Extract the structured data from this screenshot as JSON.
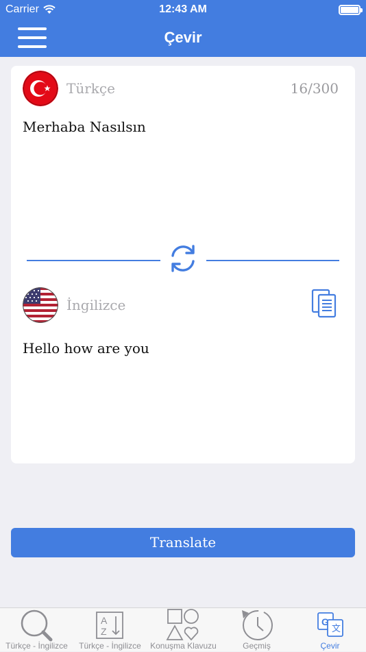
{
  "status_bar": {
    "carrier": "Carrier",
    "time": "12:43 AM"
  },
  "nav": {
    "title": "Çevir"
  },
  "source": {
    "language": "Türkçe",
    "counter": "16/300",
    "text": "Merhaba Nasılsın",
    "flag_icon": "turkey-flag-icon"
  },
  "target": {
    "language": "İngilizce",
    "text": "Hello how are you",
    "flag_icon": "usa-flag-icon"
  },
  "translate_label": "Translate",
  "tabs": [
    {
      "label": "Türkçe - İngilizce",
      "icon": "search-icon"
    },
    {
      "label": "Türkçe - İngilizce",
      "icon": "sort-az-icon"
    },
    {
      "label": "Konuşma Klavuzu",
      "icon": "shapes-icon"
    },
    {
      "label": "Geçmiş",
      "icon": "history-icon"
    },
    {
      "label": "Çevir",
      "icon": "translate-icon",
      "active": true
    }
  ],
  "colors": {
    "accent": "#437de0",
    "background": "#efeff4",
    "card": "#ffffff"
  }
}
